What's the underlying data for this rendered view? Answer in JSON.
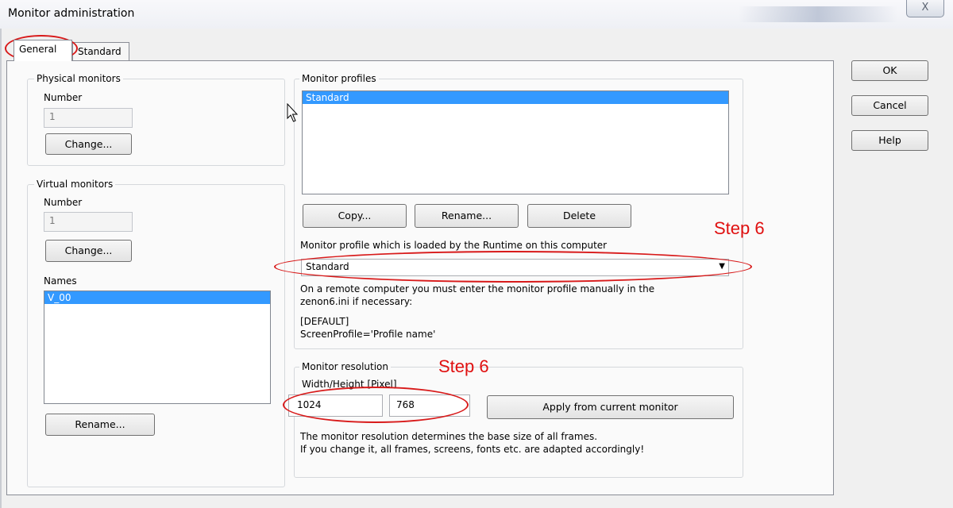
{
  "window": {
    "title": "Monitor administration",
    "close_glyph": "X"
  },
  "tabs": [
    "General",
    "Standard"
  ],
  "physical_monitors": {
    "group": "Physical monitors",
    "number_label": "Number",
    "number_value": "1",
    "change_btn": "Change..."
  },
  "virtual_monitors": {
    "group": "Virtual monitors",
    "number_label": "Number",
    "number_value": "1",
    "change_btn": "Change...",
    "names_label": "Names",
    "names": [
      "V_00"
    ],
    "rename_btn": "Rename..."
  },
  "monitor_profiles": {
    "group": "Monitor profiles",
    "profiles": [
      "Standard"
    ],
    "copy_btn": "Copy...",
    "rename_btn": "Rename...",
    "delete_btn": "Delete",
    "runtime_label": "Monitor profile which is loaded by the Runtime on this computer",
    "runtime_value": "Standard",
    "note_line1": "On a remote computer you must enter the monitor profile manually in the",
    "note_line2": "zenon6.ini if necessary:",
    "ini_line1": "[DEFAULT]",
    "ini_line2": "ScreenProfile='Profile name'"
  },
  "monitor_resolution": {
    "group": "Monitor resolution",
    "label": "Width/Height [Pixel]",
    "width": "1024",
    "height": "768",
    "apply_btn": "Apply from current monitor",
    "note_line1": "The monitor resolution determines the base size of all frames.",
    "note_line2": "If you change it, all frames, screens, fonts etc. are adapted accordingly!"
  },
  "dialog_buttons": {
    "ok": "OK",
    "cancel": "Cancel",
    "help": "Help"
  },
  "annotations": {
    "step_a": "Step 6",
    "step_b": "Step 6",
    "color": "#e01010"
  }
}
